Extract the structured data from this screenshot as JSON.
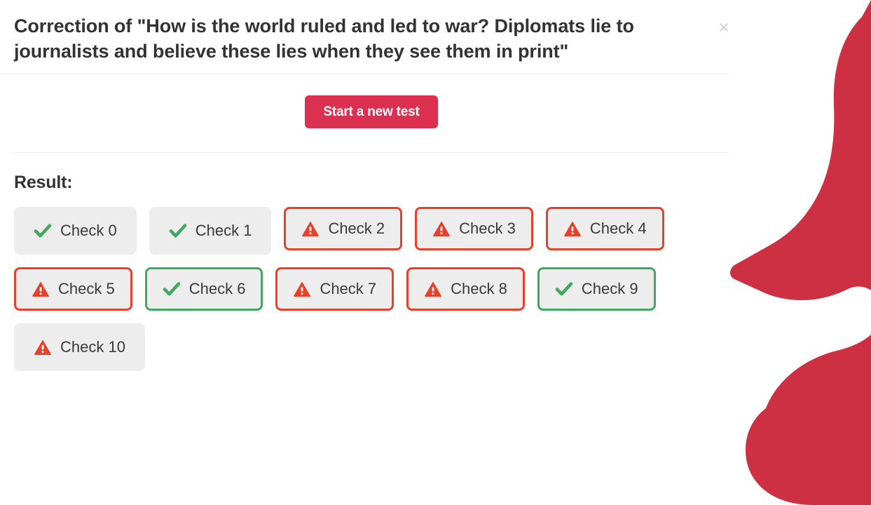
{
  "modal": {
    "title": "Correction of \"How is the world ruled and led to war? Diplomats lie to journalists and believe these lies when they see them in print\"",
    "close_label": "×",
    "close_icon": "close-icon"
  },
  "actions": {
    "start_test_label": "Start a new test"
  },
  "result": {
    "heading": "Result:",
    "checks": [
      {
        "label": "Check 0",
        "status": "pass",
        "icon": "check-mark-icon",
        "bordered": false
      },
      {
        "label": "Check 1",
        "status": "pass",
        "icon": "check-mark-icon",
        "bordered": false
      },
      {
        "label": "Check 2",
        "status": "fail",
        "icon": "warning-triangle-icon",
        "bordered": true
      },
      {
        "label": "Check 3",
        "status": "fail",
        "icon": "warning-triangle-icon",
        "bordered": true
      },
      {
        "label": "Check 4",
        "status": "fail",
        "icon": "warning-triangle-icon",
        "bordered": true
      },
      {
        "label": "Check 5",
        "status": "fail",
        "icon": "warning-triangle-icon",
        "bordered": true
      },
      {
        "label": "Check 6",
        "status": "pass",
        "icon": "check-mark-icon",
        "bordered": true
      },
      {
        "label": "Check 7",
        "status": "fail",
        "icon": "warning-triangle-icon",
        "bordered": true
      },
      {
        "label": "Check 8",
        "status": "fail",
        "icon": "warning-triangle-icon",
        "bordered": true
      },
      {
        "label": "Check 9",
        "status": "pass",
        "icon": "check-mark-icon",
        "bordered": true
      },
      {
        "label": "Check 10",
        "status": "fail",
        "icon": "warning-triangle-icon",
        "bordered": false
      }
    ]
  },
  "brand": {
    "logo_name": "seahorse-logo",
    "logo_color": "#ce3043"
  },
  "colors": {
    "accent": "#dc3050",
    "pass": "#41a85f",
    "fail": "#e8412b",
    "chip_bg": "#ededed",
    "text": "#333333",
    "divider": "#e9e9e9"
  }
}
